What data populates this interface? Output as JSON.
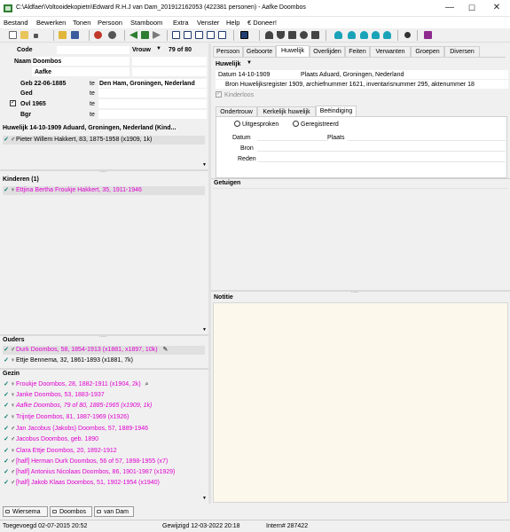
{
  "window": {
    "title": "C:\\Aldfaer\\Voltooidekopietn\\Edward R.H.J van Dam_201912162053 (422381 personen) - Aafke Doombos",
    "minimize": "—",
    "maximize": "☐",
    "close": "✕"
  },
  "menu": [
    "Bestand",
    "Bewerken",
    "Tonen",
    "Persoon",
    "Stamboom",
    "Extra",
    "Venster",
    "Help",
    "€ Doneer!"
  ],
  "person": {
    "code_label": "Code",
    "gender": "Vrouw",
    "counter": "79 of 80",
    "naam_label": "Naam",
    "surname": "Doombos",
    "firstname": "Aafke",
    "geb_label": "Geb 22-06-1885",
    "geb_te": "te",
    "geb_place": "Den Ham, Groningen, Nederland",
    "ged_label": "Ged",
    "ged_te": "te",
    "ovl_label": "Ovl 1965",
    "ovl_te": "te",
    "bgr_label": "Bgr",
    "bgr_te": "te"
  },
  "marriage": {
    "header": "Huwelijk 14-10-1909 Aduard, Groningen, Nederland (Kind...",
    "partner": "Pieter Willem Hakkert, 83, 1875-1958 (x1909, 1k)"
  },
  "children": {
    "header": "Kinderen (1)",
    "items": [
      "Ettjina Bertha Froukje Hakkert, 35, 1911-1946"
    ]
  },
  "parents": {
    "header": "Ouders",
    "items": [
      {
        "name": "Durk Doombos, 58, 1854-1913 (x1881, x1897, 10k)",
        "sex": "♂",
        "pink": true
      },
      {
        "name": "Ettje Bennema, 32, 1861-1893 (x1881, 7k)",
        "sex": "♀",
        "pink": false
      }
    ]
  },
  "family": {
    "header": "Gezin",
    "items": [
      {
        "name": "Froukje Doombos, 28, 1882-1911 (x1904, 2k)",
        "sex": "♀",
        "italic": false
      },
      {
        "name": "Janke Doombos, 53, 1883-1937",
        "sex": "♀",
        "italic": false
      },
      {
        "name": "Aafke Doombos, 79 of 80, 1885-1965 (x1909, 1k)",
        "sex": "♀",
        "italic": true
      },
      {
        "name": "Trijntje Doombos, 81, 1887-1969 (x1926)",
        "sex": "♀",
        "italic": false
      },
      {
        "name": "Jan Jacobus (Jakobs) Doombos, 57, 1889-1946",
        "sex": "♂",
        "italic": false
      },
      {
        "name": "Jacobus Doombos, geb. 1890",
        "sex": "♂",
        "italic": false
      },
      {
        "name": "Clara Ettje Doombos, 20, 1892-1912",
        "sex": "♀",
        "italic": false
      },
      {
        "name": "[half] Herman Durk Doombos, 56 of 57, 1898-1955 (x7)",
        "sex": "♂",
        "italic": false
      },
      {
        "name": "[half] Antonius Nicolaas Doombos, 86, 1901-1987 (x1929)",
        "sex": "♂",
        "italic": false
      },
      {
        "name": "[half] Jakob Klaas Doombos, 51, 1902-1954 (x1940)",
        "sex": "♂",
        "italic": false
      }
    ]
  },
  "bottom_tabs": [
    "Wiersema",
    "Doombos",
    "van Dam"
  ],
  "tabs": [
    "Persoon",
    "Geboorte",
    "Huwelijk",
    "Overlijden",
    "Feiten",
    "Verwanten",
    "Groepen",
    "Diversen"
  ],
  "huwelijk": {
    "title": "Huwelijk",
    "datum": "Datum 14-10-1909",
    "plaats": "Plaats Aduard, Groningen, Nederland",
    "bron": "Bron Huwelijksregister 1909, archiefnummer 1621, inventarisnummer 295, aktenummer 18",
    "kinderloos": "Kinderloos"
  },
  "subtabs": [
    "Ondertrouw",
    "Kerkelijk huwelijk",
    "Beëindiging"
  ],
  "beeindiging": {
    "uitgesproken": "Uitgesproken",
    "geregistreerd": "Geregistreerd",
    "datum": "Datum",
    "plaats": "Plaats",
    "bron": "Bron",
    "reden": "Reden"
  },
  "getuigen": "Getuigen",
  "notitie": "Notitie",
  "status": {
    "added": "Toegevoegd 02-07-2015 20:52",
    "changed": "Gewijzigd 12-03-2022 20:18",
    "intern": "Intern# 287422"
  },
  "colors": {
    "pink": "#e000d0",
    "teal": "#007a6a",
    "notes_bg": "#fdf8ec"
  }
}
